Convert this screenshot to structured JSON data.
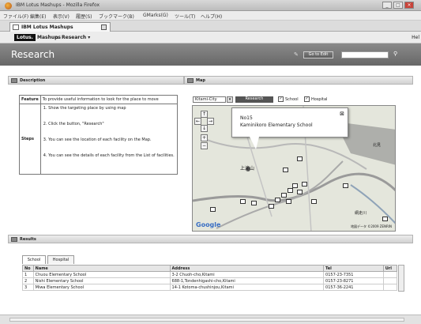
{
  "browser": {
    "window_title": "IBM Lotus Mashups - Mozilla Firefox",
    "menu": [
      "ファイル(F)",
      "編集(E)",
      "表示(V)",
      "履歴(S)",
      "ブックマーク(B)",
      "GMarks(G)",
      "ツール(T)",
      "ヘルプ(H)"
    ],
    "tab_label": "IBM Lotus Mashups"
  },
  "app": {
    "brand": "Lotus.",
    "brand_name": "Mashups",
    "page_menu": "Research ▾",
    "help": "Hel",
    "page_title": "Research",
    "edit_button": "Go to Edit"
  },
  "description": {
    "panel_title": "Description",
    "feature_label": "Feature",
    "feature_text": "To provide useful information to look for the place to move",
    "steps_label": "Steps",
    "steps": [
      "1. Show the targeting place by using map",
      "2. Click the button, \"Research\"",
      "3. You can see the location of each facility on the Map.",
      "4. You can see the details of each facility from the List of facilities."
    ]
  },
  "map": {
    "panel_title": "Map",
    "city_select": "Kitami-City",
    "research_button": "Research",
    "check_school": "School",
    "check_hospital": "Hospital",
    "balloon_no": "No15",
    "balloon_name": "Kaminikoro Elementary School",
    "labels": [
      "上滝山",
      "北見",
      "網走川"
    ],
    "attribution": "地図データ ©2009 ZENRIN"
  },
  "results": {
    "panel_title": "Results",
    "tabs": [
      "School",
      "Hospital"
    ],
    "columns": [
      "No",
      "Name",
      "Address",
      "Tel",
      "Url"
    ],
    "rows": [
      {
        "no": "1",
        "name": "Chuou Elementary School",
        "address": "3-2 Chuoh-cho,Kitami",
        "tel": "0157-23-7351",
        "url": ""
      },
      {
        "no": "2",
        "name": "Nishi Elementary School",
        "address": "688-1,Tondenhigashi-cho,Kitami",
        "tel": "0157-23-8271",
        "url": ""
      },
      {
        "no": "3",
        "name": "Miwa Elementary School",
        "address": "14-1 Kotoma-chushinjou,Kitami",
        "tel": "0157-36-2241",
        "url": ""
      }
    ]
  }
}
